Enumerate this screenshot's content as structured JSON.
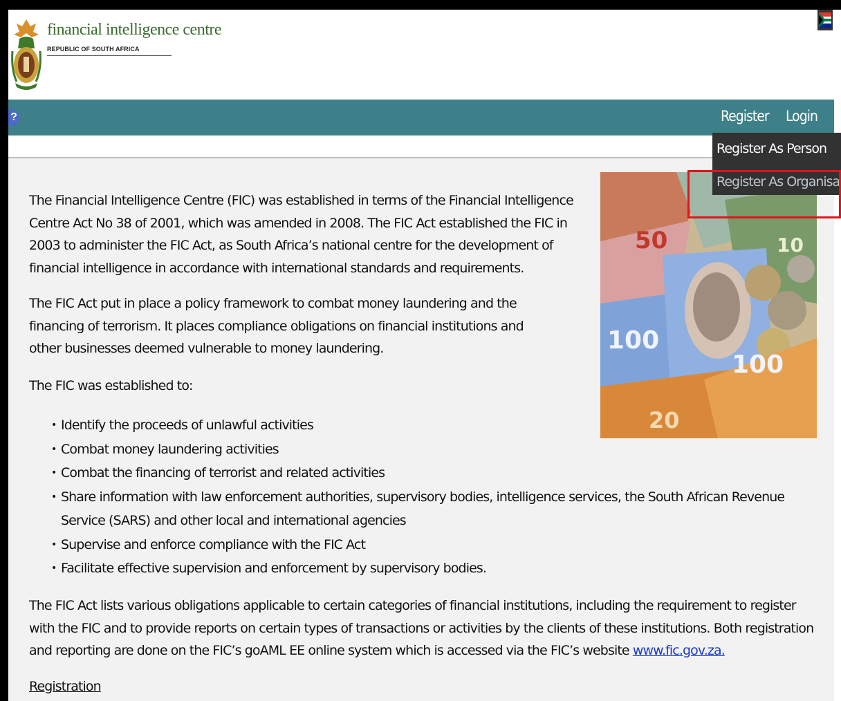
{
  "header": {
    "org_name": "financial intelligence centre",
    "org_subtitle": "REPUBLIC OF SOUTH AFRICA"
  },
  "nav": {
    "help_label": "?",
    "register": "Register",
    "login": "Login"
  },
  "dropdown": {
    "items": [
      "Register As Person",
      "Register As Organisation"
    ]
  },
  "hero_image": {
    "banknote_labels": [
      "50",
      "100",
      "100",
      "10",
      "20"
    ]
  },
  "content": {
    "p1": "The Financial Intelligence Centre (FIC) was established in terms of the Financial Intelligence Centre Act No 38 of 2001, which was amended in 2008. The FIC Act established the FIC in 2003 to administer the FIC Act, as South Africa’s national centre for the development of financial intelligence in accordance with international standards and requirements.",
    "p2": "The FIC Act put in place a policy framework to combat money laundering and the financing of terrorism. It places compliance obligations on financial institutions and other businesses deemed vulnerable to money laundering.",
    "p3": "The FIC was established to:",
    "bullets": [
      "Identify the proceeds of unlawful activities",
      "Combat money laundering activities",
      "Combat the financing of terrorist and related activities",
      "Share information with law enforcement authorities, supervisory bodies, intelligence services, the South African Revenue Service (SARS) and other local and international agencies",
      "Supervise and enforce compliance with the FIC Act",
      "Facilitate effective supervision and enforcement by supervisory bodies."
    ],
    "p4_text": "The FIC Act lists various obligations applicable to certain categories of financial institutions, including the requirement to register with the FIC and to provide reports on certain types of transactions or activities by the clients of these institutions. Both registration and reporting are done on the FIC’s goAML EE online system which is accessed via the FIC’s website ",
    "p4_link": "www.fic.gov.za.",
    "registration_heading": "Registration"
  }
}
